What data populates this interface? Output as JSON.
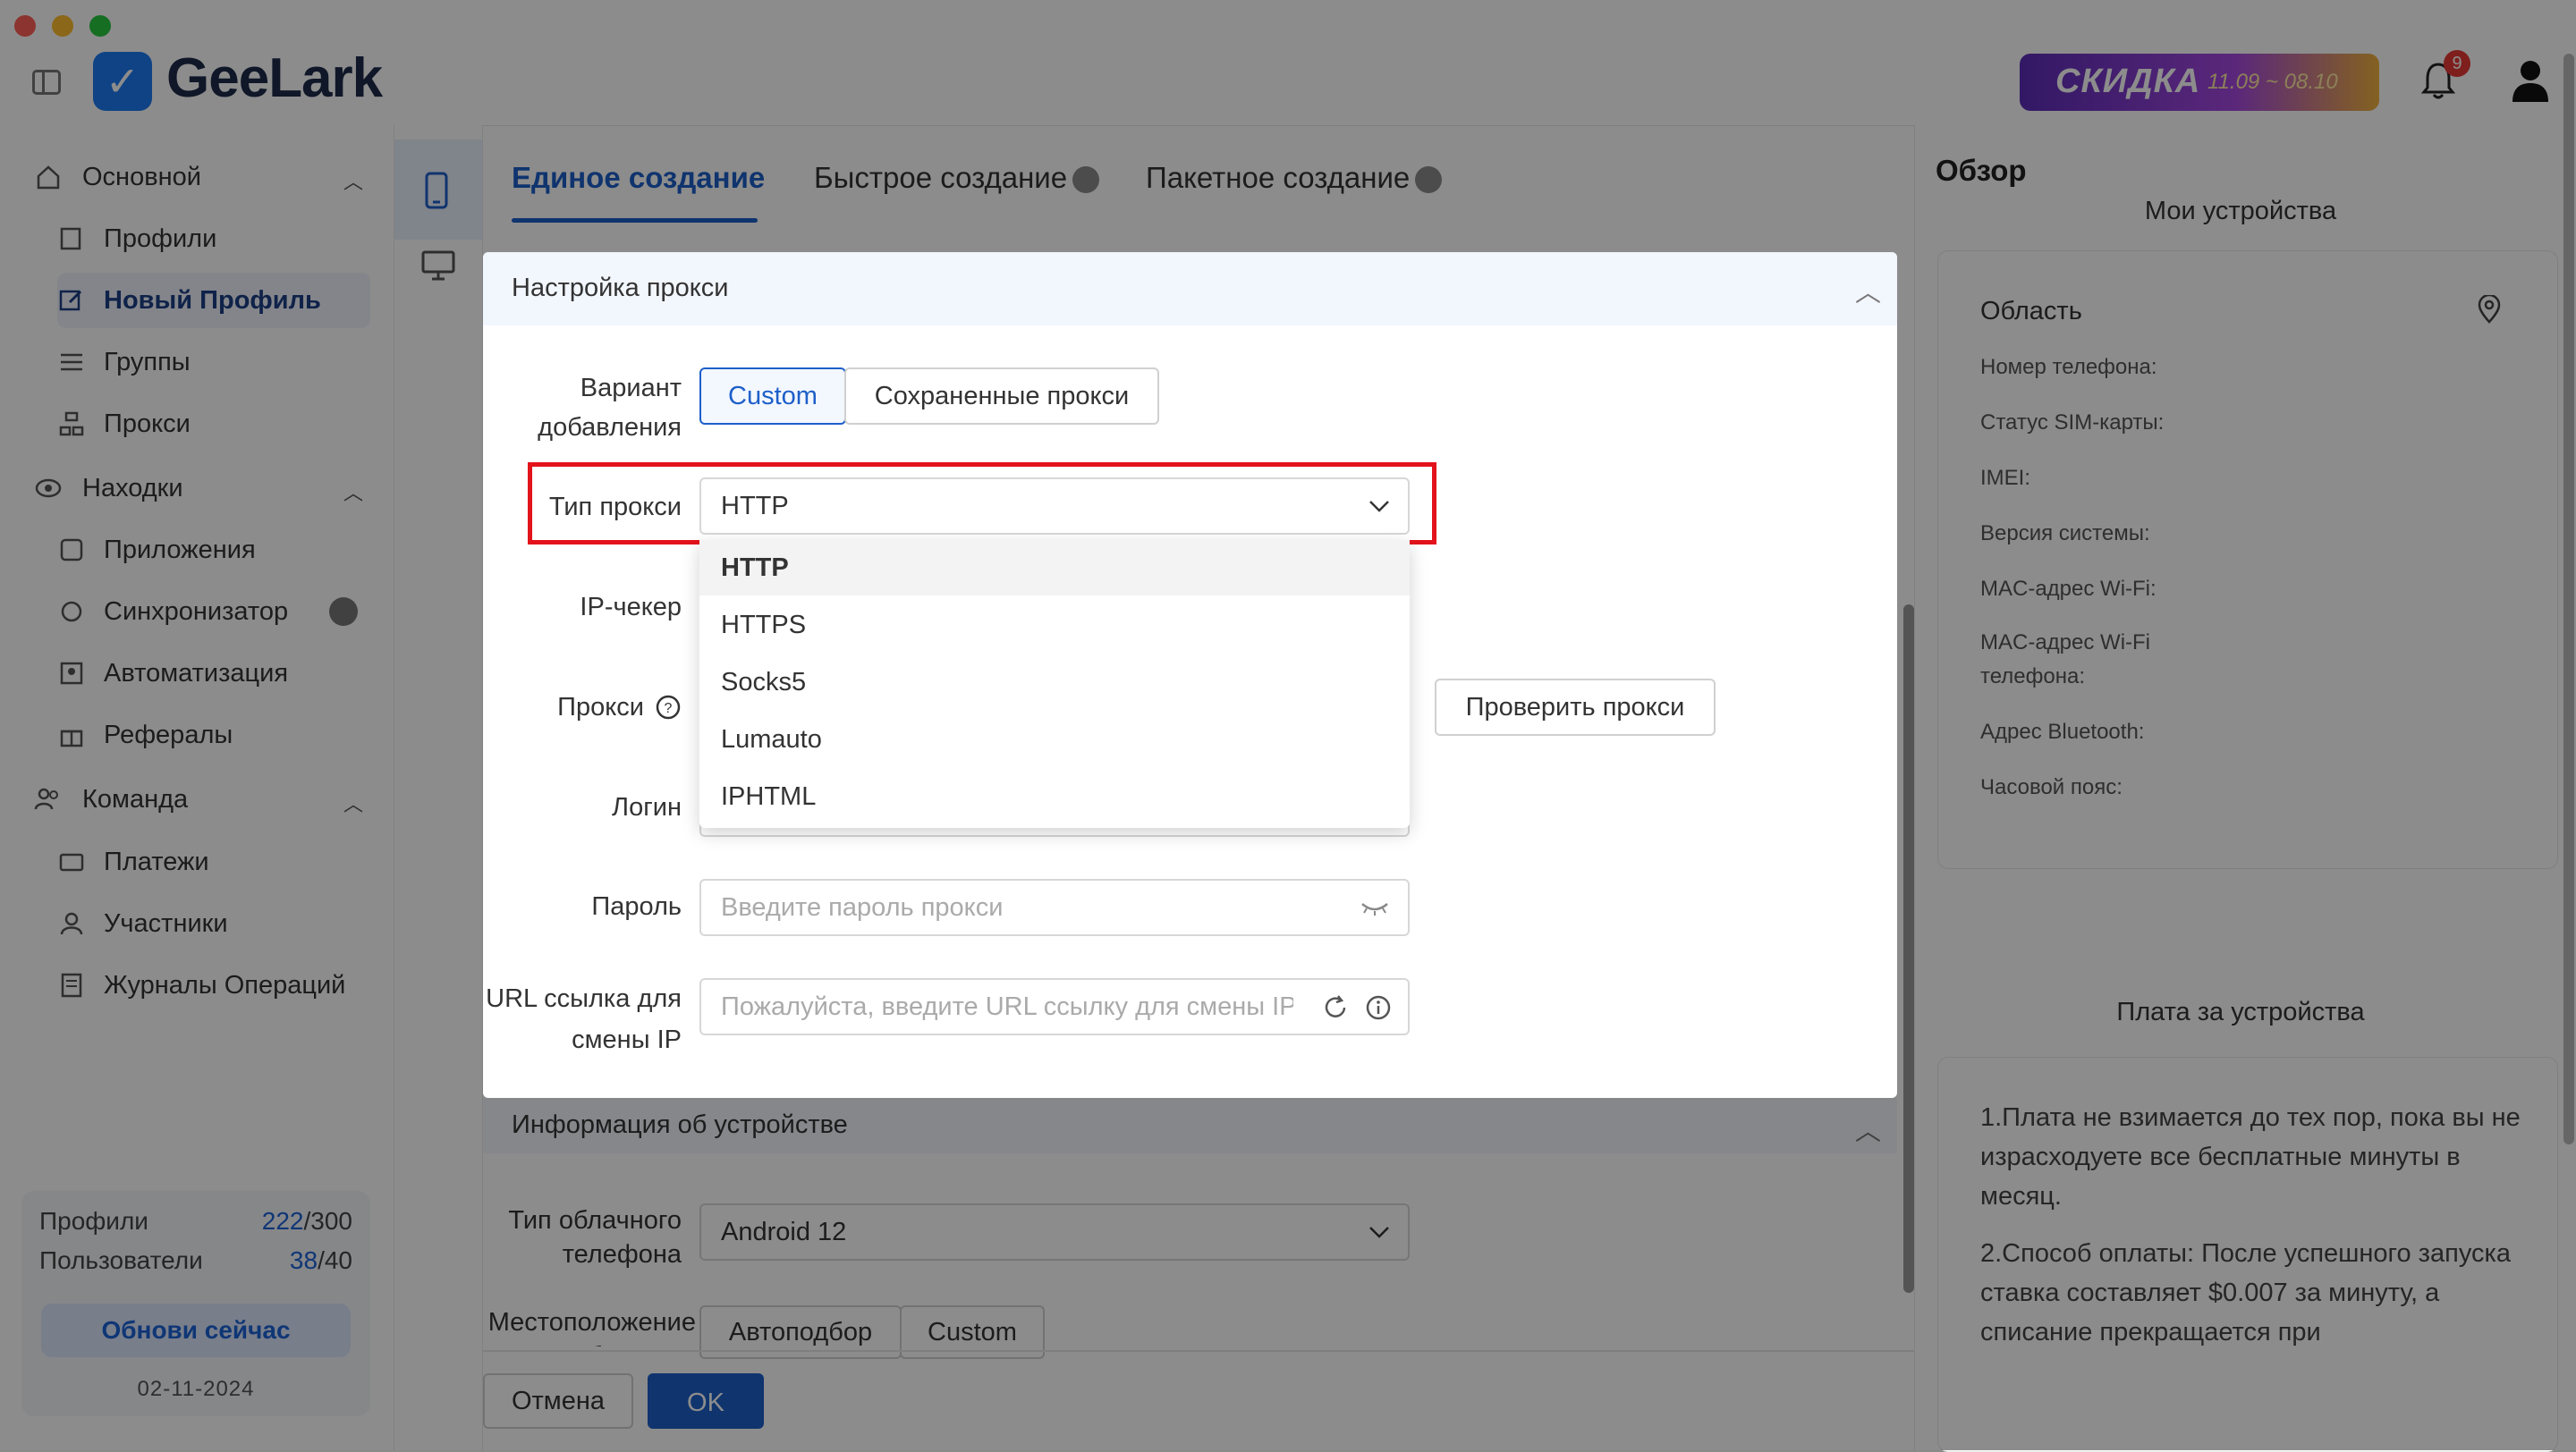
{
  "app": {
    "name": "GeeLark"
  },
  "promo": {
    "text": "СКИДКА",
    "dates": "11.09 ~ 08.10"
  },
  "notifications": {
    "count": "9"
  },
  "sidebar": {
    "sections": [
      {
        "label": "Основной",
        "items": [
          "Профили",
          "Новый Профиль",
          "Группы",
          "Прокси"
        ]
      },
      {
        "label": "Находки",
        "items": [
          "Приложения",
          "Синхронизатор",
          "Автоматизация",
          "Рефералы"
        ]
      },
      {
        "label": "Команда",
        "items": [
          "Платежи",
          "Участники",
          "Журналы Операций"
        ]
      }
    ],
    "active_item": "Новый Профиль"
  },
  "stats": {
    "profiles_label": "Профили",
    "profiles_used": "222",
    "profiles_total": "/300",
    "users_label": "Пользователи",
    "users_used": "38",
    "users_total": "/40",
    "update_label": "Обнови сейчас",
    "date": "02-11-2024"
  },
  "tabs": [
    "Единое создание",
    "Быстрое создание",
    "Пакетное создание"
  ],
  "proxy_section": {
    "title": "Настройка прокси",
    "variant_label": "Вариант добавления",
    "variant_options": [
      "Custom",
      "Сохраненные прокси"
    ],
    "type_label": "Тип прокси",
    "type_value": "HTTP",
    "type_options": [
      "HTTP",
      "HTTPS",
      "Socks5",
      "Lumauto",
      "IPHTML"
    ],
    "ip_checker_label": "IP-чекер",
    "proxy_label": "Прокси",
    "check_button": "Проверить прокси",
    "login_label": "Логин",
    "password_label": "Пароль",
    "password_placeholder": "Введите пароль прокси",
    "url_label": "URL ссылка для смены IP",
    "url_placeholder": "Пожалуйста, введите URL ссылку для смены IP..."
  },
  "device_section": {
    "title": "Информация об устройстве",
    "cloud_type_label": "Тип облачного телефона",
    "cloud_type_value": "Android 12",
    "location_label": "Местоположение облачного",
    "location_options": [
      "Автоподбор",
      "Custom"
    ]
  },
  "footer_buttons": {
    "cancel": "Отмена",
    "ok": "OK"
  },
  "overview": {
    "title": "Обзор",
    "my_devices": "Мои устройства",
    "region_label": "Область",
    "fields": [
      "Номер телефона:",
      "Статус SIM-карты:",
      "IMEI:",
      "Версия системы:",
      "MAC-адрес Wi-Fi:",
      "MAC-адрес Wi-Fi телефона:",
      "Адрес Bluetooth:",
      "Часовой пояс:"
    ],
    "fee_title": "Плата за устройства",
    "fee_text_1": "1.Плата не взимается до тех пор, пока вы не израсходуете все бесплатные минуты в месяц.",
    "fee_text_2": "2.Способ оплаты: После успешного запуска ставка составляет $0.007 за минуту, а списание прекращается при"
  },
  "colors": {
    "accent": "#1d5fc9",
    "highlight_box": "#e3131b",
    "badge": "#e53935"
  }
}
